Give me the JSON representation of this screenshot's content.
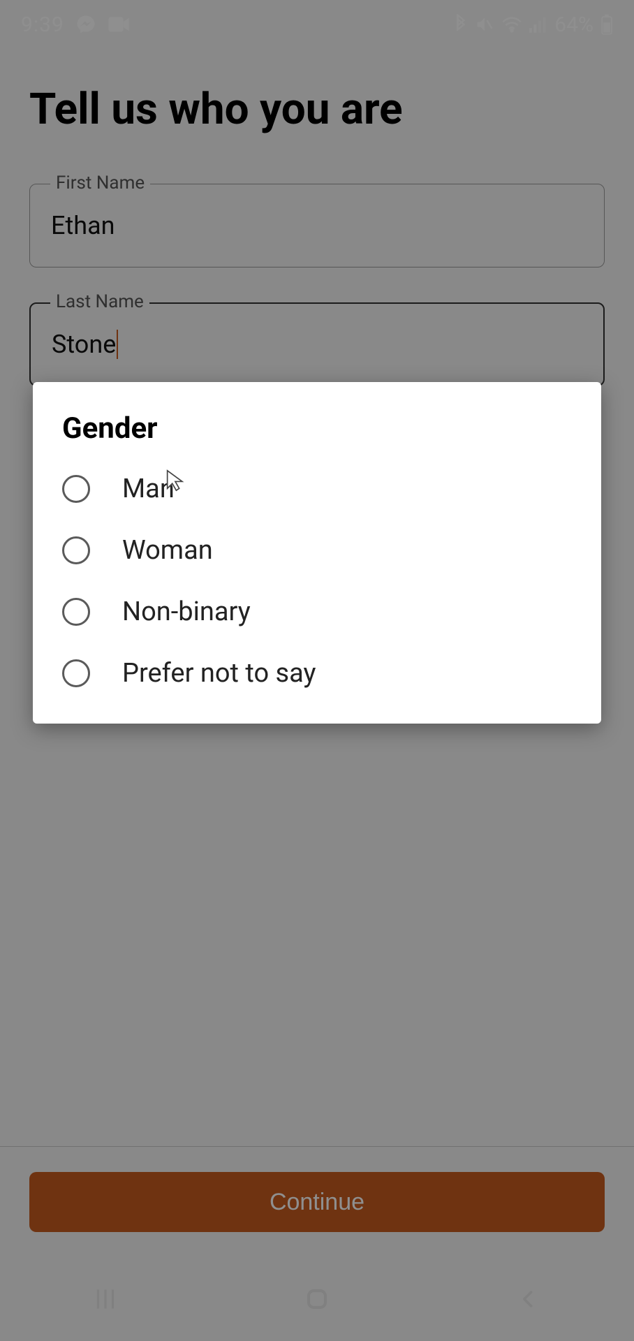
{
  "status": {
    "time": "9:39",
    "battery": "64%"
  },
  "page": {
    "title": "Tell us who you are"
  },
  "fields": {
    "first": {
      "label": "First Name",
      "value": "Ethan"
    },
    "last": {
      "label": "Last Name",
      "value": "Stone"
    }
  },
  "dialog": {
    "title": "Gender",
    "options": {
      "o0": "Man",
      "o1": "Woman",
      "o2": "Non-binary",
      "o3": "Prefer not to say"
    }
  },
  "actions": {
    "continue": "Continue"
  }
}
